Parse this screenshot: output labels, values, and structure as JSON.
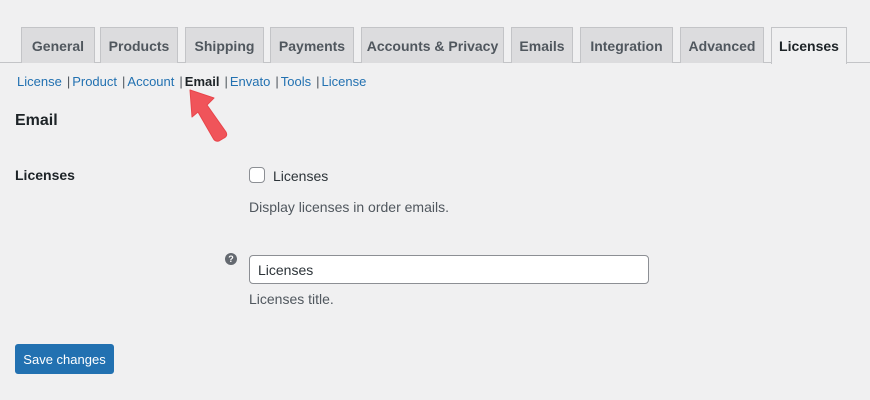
{
  "tabs": [
    {
      "label": "General"
    },
    {
      "label": "Products"
    },
    {
      "label": "Shipping"
    },
    {
      "label": "Payments"
    },
    {
      "label": "Accounts & Privacy"
    },
    {
      "label": "Emails"
    },
    {
      "label": "Integration"
    },
    {
      "label": "Advanced"
    },
    {
      "label": "Licenses",
      "active": true
    }
  ],
  "subnav": [
    {
      "label": "License"
    },
    {
      "label": "Product"
    },
    {
      "label": "Account"
    },
    {
      "label": "Email",
      "current": true
    },
    {
      "label": "Envato"
    },
    {
      "label": "Tools"
    },
    {
      "label": "License"
    }
  ],
  "section": {
    "title": "Email",
    "row_label": "Licenses",
    "checkbox_label": "Licenses",
    "checkbox_checked": false,
    "checkbox_description": "Display licenses in order emails.",
    "help_icon": "?",
    "title_input_value": "Licenses",
    "title_input_description": "Licenses title."
  },
  "save_button": "Save changes",
  "colors": {
    "accent": "#2271b1",
    "arrow": "#f0545a"
  },
  "icons": [
    "help-icon",
    "pointer-arrow-icon"
  ]
}
